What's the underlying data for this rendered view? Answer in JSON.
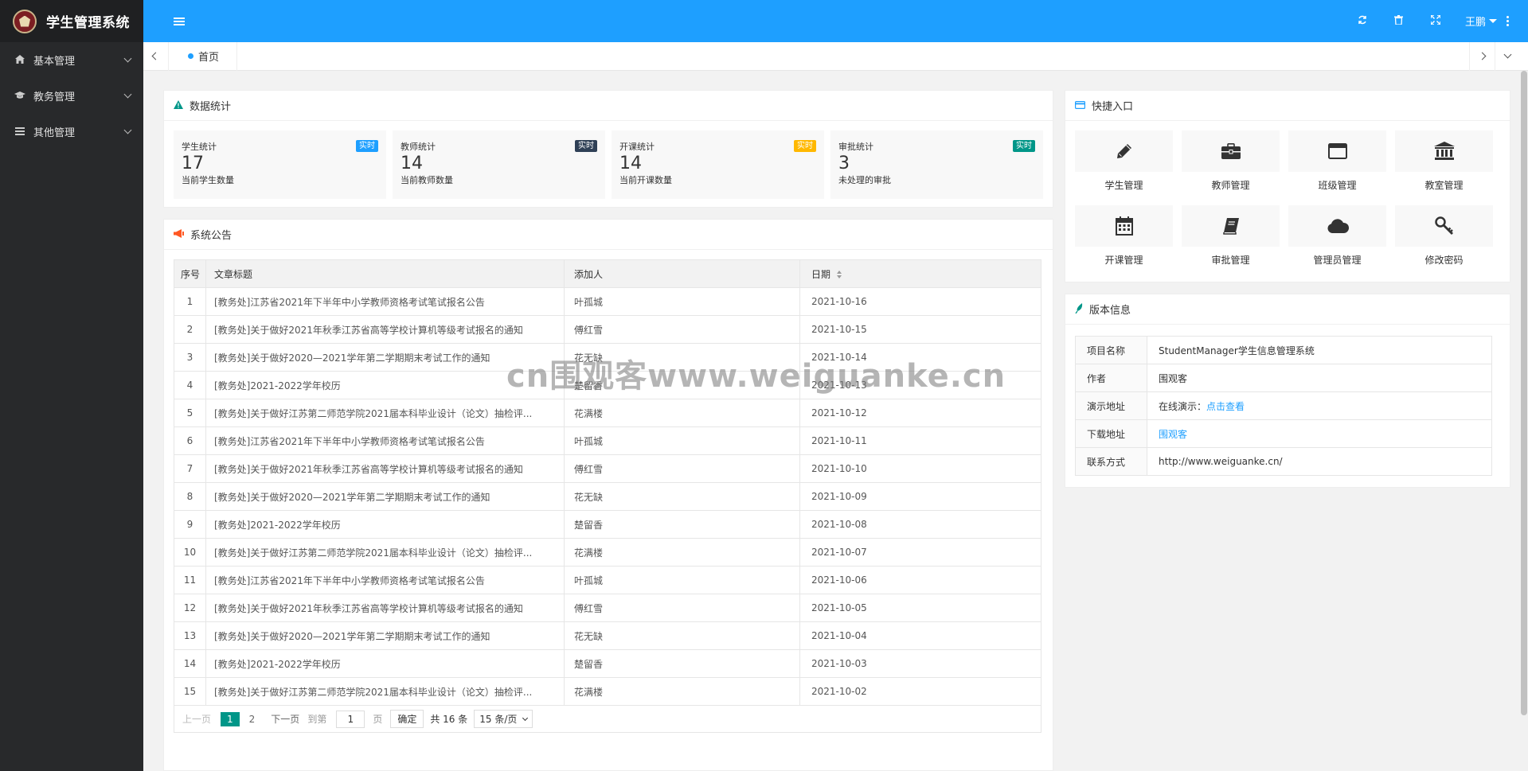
{
  "app": {
    "title": "学生管理系统"
  },
  "sidebar": {
    "items": [
      {
        "label": "基本管理",
        "icon": "home-icon"
      },
      {
        "label": "教务管理",
        "icon": "graduation-cap-icon"
      },
      {
        "label": "其他管理",
        "icon": "list-icon"
      }
    ]
  },
  "header": {
    "user": "王鹏"
  },
  "tabs": {
    "home": "首页"
  },
  "stats": {
    "title": "数据统计",
    "cards": [
      {
        "label": "学生统计",
        "value": "17",
        "desc": "当前学生数量",
        "badge": "实时",
        "color": "#1e9fff"
      },
      {
        "label": "教师统计",
        "value": "14",
        "desc": "当前教师数量",
        "badge": "实时",
        "color": "#2f4056"
      },
      {
        "label": "开课统计",
        "value": "14",
        "desc": "当前开课数量",
        "badge": "实时",
        "color": "#ffb800"
      },
      {
        "label": "审批统计",
        "value": "3",
        "desc": "未处理的审批",
        "badge": "实时",
        "color": "#009688"
      }
    ]
  },
  "notice": {
    "title": "系统公告",
    "columns": [
      "序号",
      "文章标题",
      "添加人",
      "日期"
    ],
    "rows": [
      [
        "1",
        "[教务处]江苏省2021年下半年中小学教师资格考试笔试报名公告",
        "叶孤城",
        "2021-10-16"
      ],
      [
        "2",
        "[教务处]关于做好2021年秋季江苏省高等学校计算机等级考试报名的通知",
        "傅红雪",
        "2021-10-15"
      ],
      [
        "3",
        "[教务处]关于做好2020—2021学年第二学期期末考试工作的通知",
        "花无缺",
        "2021-10-14"
      ],
      [
        "4",
        "[教务处]2021-2022学年校历",
        "楚留香",
        "2021-10-13"
      ],
      [
        "5",
        "[教务处]关于做好江苏第二师范学院2021届本科毕业设计（论文）抽检评...",
        "花满楼",
        "2021-10-12"
      ],
      [
        "6",
        "[教务处]江苏省2021年下半年中小学教师资格考试笔试报名公告",
        "叶孤城",
        "2021-10-11"
      ],
      [
        "7",
        "[教务处]关于做好2021年秋季江苏省高等学校计算机等级考试报名的通知",
        "傅红雪",
        "2021-10-10"
      ],
      [
        "8",
        "[教务处]关于做好2020—2021学年第二学期期末考试工作的通知",
        "花无缺",
        "2021-10-09"
      ],
      [
        "9",
        "[教务处]2021-2022学年校历",
        "楚留香",
        "2021-10-08"
      ],
      [
        "10",
        "[教务处]关于做好江苏第二师范学院2021届本科毕业设计（论文）抽检评...",
        "花满楼",
        "2021-10-07"
      ],
      [
        "11",
        "[教务处]江苏省2021年下半年中小学教师资格考试笔试报名公告",
        "叶孤城",
        "2021-10-06"
      ],
      [
        "12",
        "[教务处]关于做好2021年秋季江苏省高等学校计算机等级考试报名的通知",
        "傅红雪",
        "2021-10-05"
      ],
      [
        "13",
        "[教务处]关于做好2020—2021学年第二学期期末考试工作的通知",
        "花无缺",
        "2021-10-04"
      ],
      [
        "14",
        "[教务处]2021-2022学年校历",
        "楚留香",
        "2021-10-03"
      ],
      [
        "15",
        "[教务处]关于做好江苏第二师范学院2021届本科毕业设计（论文）抽检评...",
        "花满楼",
        "2021-10-02"
      ]
    ],
    "pager": {
      "prev": "上一页",
      "current": "1",
      "page2": "2",
      "next": "下一页",
      "goto": "到第",
      "page_input": "1",
      "page_unit": "页",
      "confirm": "确定",
      "total": "共 16 条",
      "per_page": "15 条/页"
    }
  },
  "quick": {
    "title": "快捷入口",
    "items": [
      {
        "label": "学生管理",
        "icon": "pencil-icon"
      },
      {
        "label": "教师管理",
        "icon": "briefcase-icon"
      },
      {
        "label": "班级管理",
        "icon": "window-icon"
      },
      {
        "label": "教室管理",
        "icon": "institution-icon"
      },
      {
        "label": "开课管理",
        "icon": "calendar-icon"
      },
      {
        "label": "审批管理",
        "icon": "book-icon"
      },
      {
        "label": "管理员管理",
        "icon": "cloud-icon"
      },
      {
        "label": "修改密码",
        "icon": "key-icon"
      }
    ]
  },
  "version": {
    "title": "版本信息",
    "project_label": "项目名称",
    "project_value": "StudentManager学生信息管理系统",
    "author_label": "作者",
    "author_value": "围观客",
    "demo_label": "演示地址",
    "demo_prefix": "在线演示：",
    "demo_link": "点击查看",
    "download_label": "下载地址",
    "download_link": "围观客",
    "contact_label": "联系方式",
    "contact_value": "http://www.weiguanke.cn/"
  },
  "watermark": "cn围观客www.weiguanke.cn",
  "colors": {
    "header": "#1e9fff",
    "sidebar": "#28292b",
    "accent": "#009688"
  }
}
